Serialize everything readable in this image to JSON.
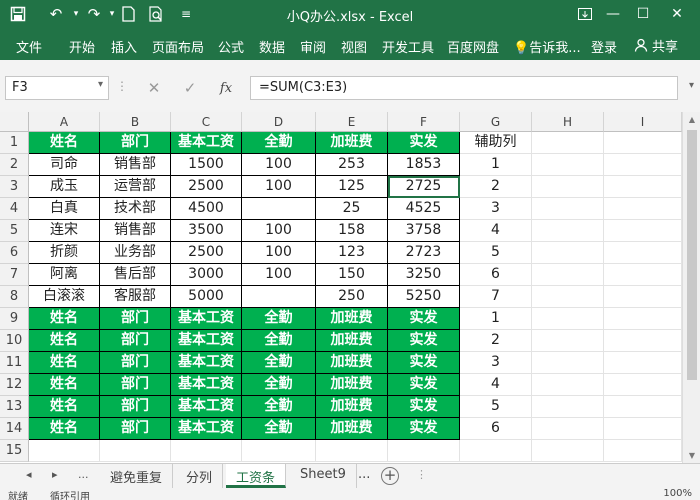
{
  "titlebar": {
    "title": "小Q办公.xlsx  -  Excel",
    "icons": [
      "save-icon",
      "undo-icon",
      "redo-icon",
      "new-file-icon",
      "print-preview-icon",
      "customize-icon"
    ]
  },
  "ribbon": {
    "tabs": [
      "文件",
      "开始",
      "插入",
      "页面布局",
      "公式",
      "数据",
      "审阅",
      "视图",
      "开发工具",
      "百度网盘"
    ],
    "tell_me": "告诉我...",
    "login": "登录",
    "share": "共享"
  },
  "formula_bar": {
    "name_box": "F3",
    "formula": "=SUM(C3:E3)"
  },
  "columns": [
    "A",
    "B",
    "C",
    "D",
    "E",
    "F",
    "G",
    "H",
    "I"
  ],
  "rows": [
    [
      "姓名",
      "部门",
      "基本工资",
      "全勤",
      "加班费",
      "实发",
      "辅助列",
      "",
      ""
    ],
    [
      "司命",
      "销售部",
      "1500",
      "100",
      "253",
      "1853",
      "1",
      "",
      ""
    ],
    [
      "成玉",
      "运营部",
      "2500",
      "100",
      "125",
      "2725",
      "2",
      "",
      ""
    ],
    [
      "白真",
      "技术部",
      "4500",
      "",
      "25",
      "4525",
      "3",
      "",
      ""
    ],
    [
      "连宋",
      "销售部",
      "3500",
      "100",
      "158",
      "3758",
      "4",
      "",
      ""
    ],
    [
      "折颜",
      "业务部",
      "2500",
      "100",
      "123",
      "2723",
      "5",
      "",
      ""
    ],
    [
      "阿离",
      "售后部",
      "3000",
      "100",
      "150",
      "3250",
      "6",
      "",
      ""
    ],
    [
      "白滚滚",
      "客服部",
      "5000",
      "",
      "250",
      "5250",
      "7",
      "",
      ""
    ],
    [
      "姓名",
      "部门",
      "基本工资",
      "全勤",
      "加班费",
      "实发",
      "1",
      "",
      ""
    ],
    [
      "姓名",
      "部门",
      "基本工资",
      "全勤",
      "加班费",
      "实发",
      "2",
      "",
      ""
    ],
    [
      "姓名",
      "部门",
      "基本工资",
      "全勤",
      "加班费",
      "实发",
      "3",
      "",
      ""
    ],
    [
      "姓名",
      "部门",
      "基本工资",
      "全勤",
      "加班费",
      "实发",
      "4",
      "",
      ""
    ],
    [
      "姓名",
      "部门",
      "基本工资",
      "全勤",
      "加班费",
      "实发",
      "5",
      "",
      ""
    ],
    [
      "姓名",
      "部门",
      "基本工资",
      "全勤",
      "加班费",
      "实发",
      "6",
      "",
      ""
    ],
    [
      "",
      "",
      "",
      "",
      "",
      "",
      "",
      "",
      ""
    ]
  ],
  "header_rows": [
    1,
    9,
    10,
    11,
    12,
    13,
    14
  ],
  "header_fill": "#00b050",
  "accent": "#217346",
  "sheet_tabs": {
    "nav": [
      "◂",
      "▸",
      "..."
    ],
    "tabs": [
      "避免重复",
      "分列",
      "工资条",
      "Sheet9"
    ],
    "active": "工资条",
    "more": "..."
  },
  "status_bar": {
    "left": "就绪",
    "mode": "循环引用",
    "zoom": "100%"
  }
}
